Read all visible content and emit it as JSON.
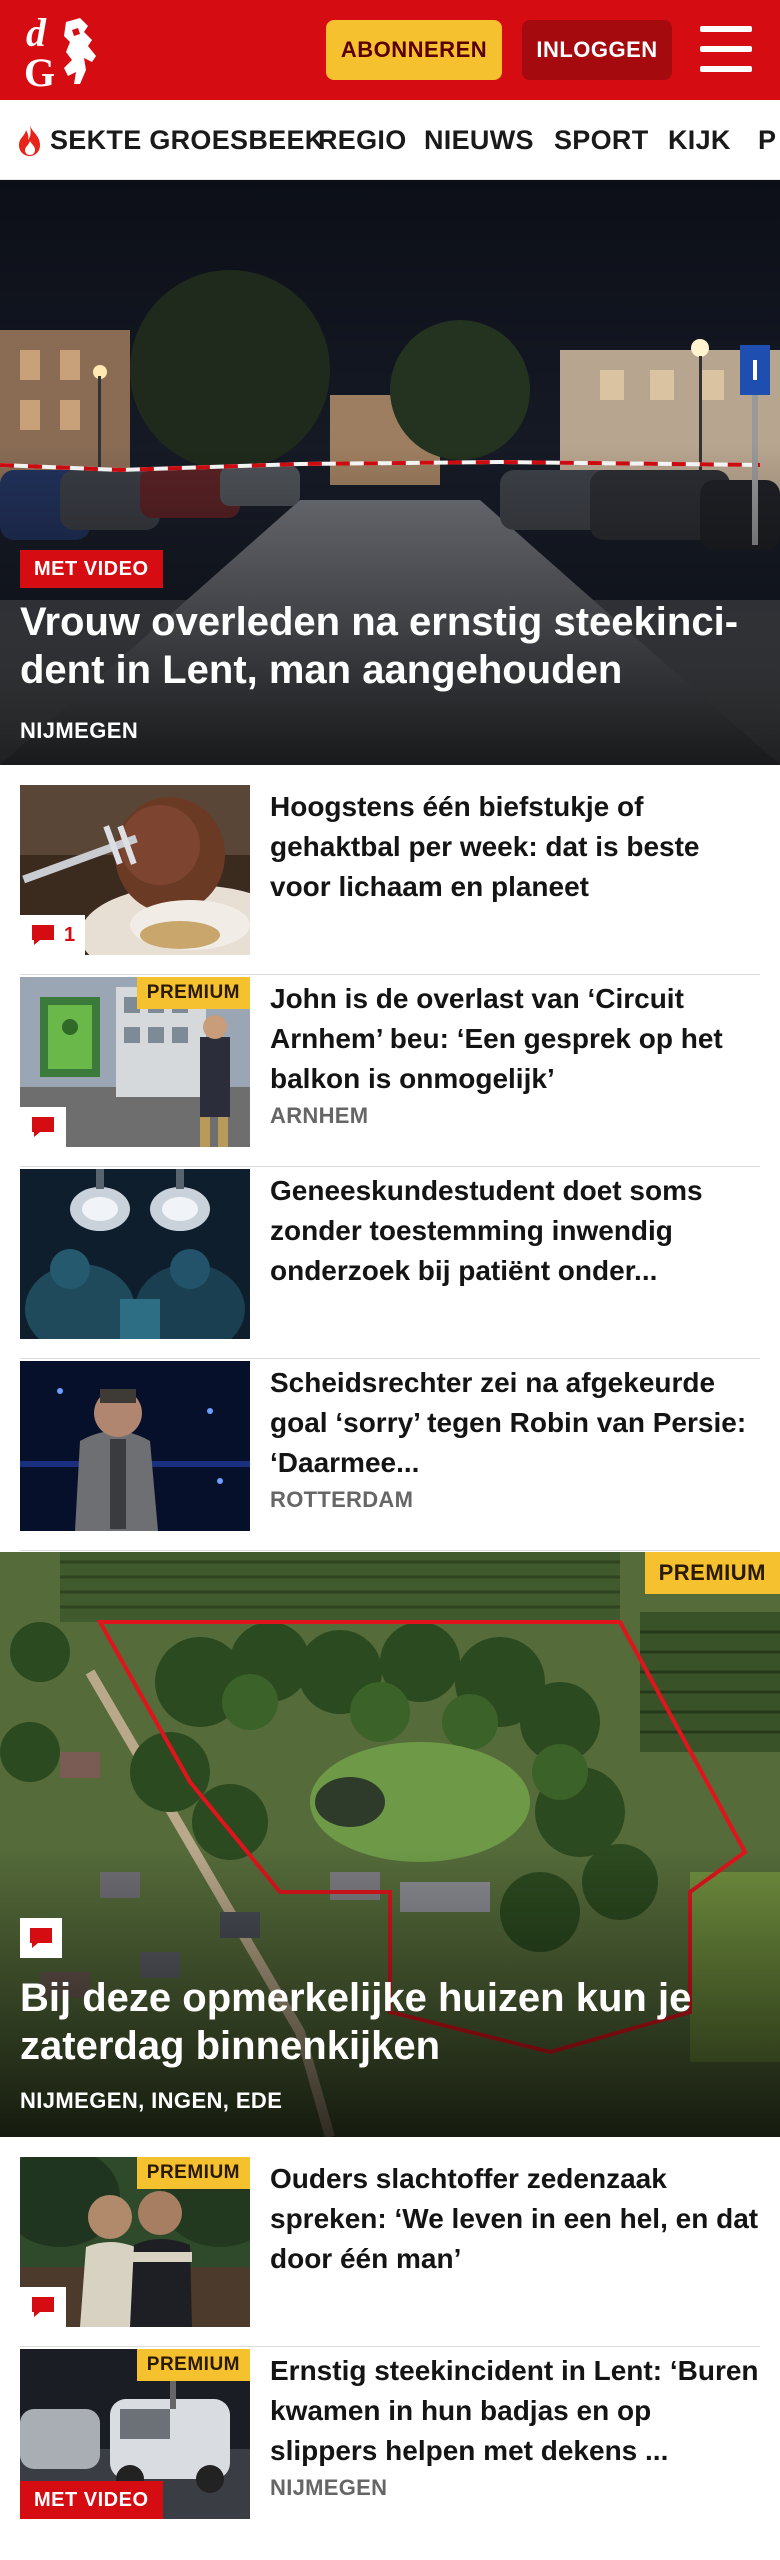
{
  "header": {
    "brand_color": "#d50c12",
    "logo_letters": "dG",
    "subscribe_label": "ABONNEREN",
    "login_label": "INLOGGEN",
    "menu_icon": "hamburger-menu-icon"
  },
  "nav": {
    "items": [
      {
        "label": "SEKTE GROESBEEK",
        "icon": "flame-icon"
      },
      {
        "label": "REGIO"
      },
      {
        "label": "NIEUWS"
      },
      {
        "label": "SPORT"
      },
      {
        "label": "KIJK"
      },
      {
        "label": "P"
      }
    ]
  },
  "hero": {
    "badge": "MET VIDEO",
    "title": "Vrouw overleden na ernstig steekinci­dent in Lent, man aangehouden",
    "location": "NIJMEGEN"
  },
  "articles": [
    {
      "title": "Hoogstens één biefstukje of gehaktbal per week: dat is beste voor lichaam en planeet",
      "comments": "1",
      "premium": "",
      "location": ""
    },
    {
      "title": "John is de overlast van ‘Circuit Arnhem’ beu: ‘Een gesprek op het balkon is onmogelijk’",
      "comments": "",
      "premium": "PREMIUM",
      "location": "ARNHEM"
    },
    {
      "title": "Geneeskundestudent doet soms zonder toestemming inwendig onderzoek bij patiënt onder...",
      "comments": "",
      "premium": "",
      "location": ""
    },
    {
      "title": "Scheidsrechter zei na afgekeurde goal ‘sorry’ tegen Robin van Persie: ‘Daarmee...",
      "comments": "",
      "premium": "",
      "location": "ROTTERDAM"
    }
  ],
  "feature": {
    "premium": "PREMIUM",
    "title": "Bij deze opmerkelijke huizen kun je zaterdag binnenkijken",
    "location": "NIJMEGEN, INGEN, EDE"
  },
  "articles2": [
    {
      "title": "Ouders slachtoffer zedenzaak spreken: ‘We leven in een hel, en dat door één man’",
      "premium": "PREMIUM",
      "location": ""
    },
    {
      "title": "Ernstig steekincident in Lent: ‘Buren kwamen in hun badjas en op slippers helpen met dekens ...",
      "premium": "PREMIUM",
      "badge": "MET VIDEO",
      "location": "NIJMEGEN"
    }
  ],
  "colors": {
    "accent_red": "#d50c12",
    "premium_yellow": "#f5c12e",
    "login_dark_red": "#a50a0e"
  }
}
